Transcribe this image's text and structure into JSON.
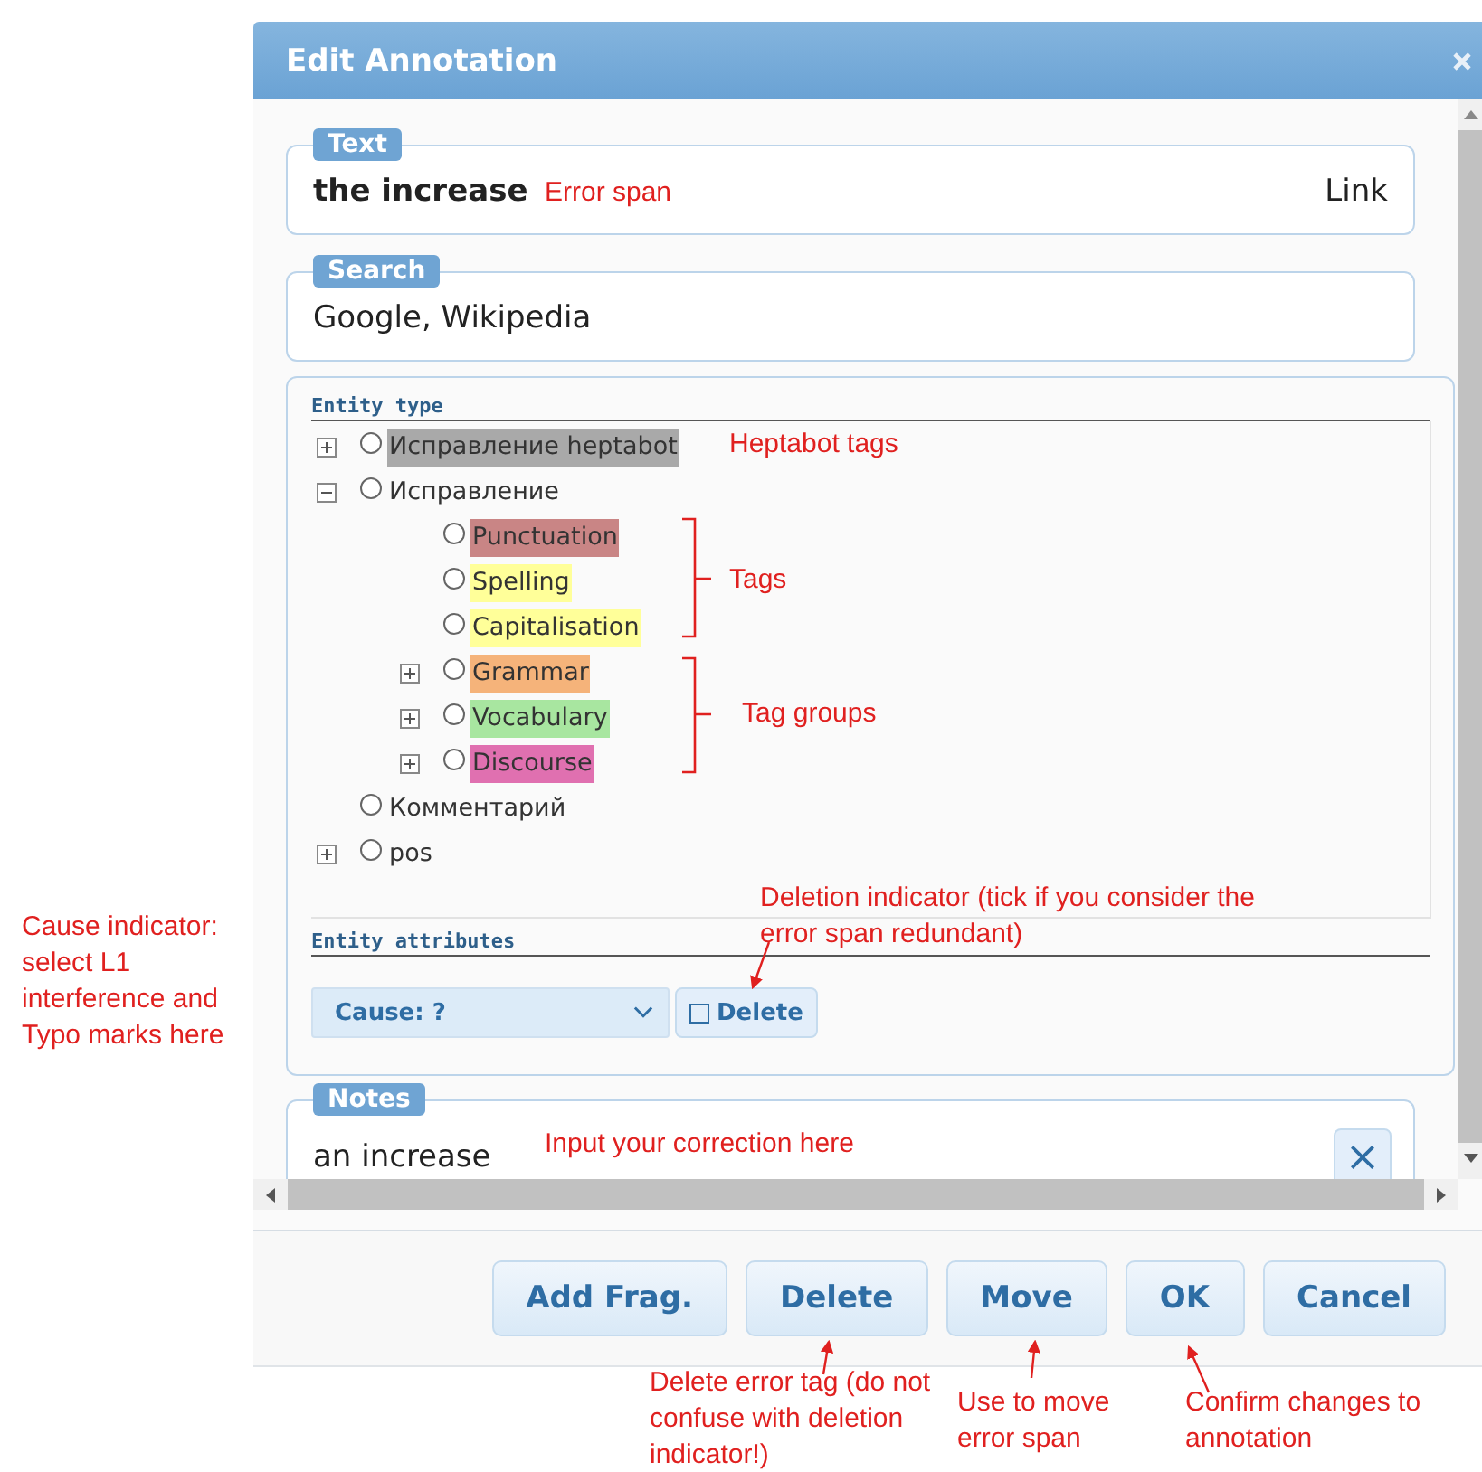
{
  "window": {
    "title": "Edit Annotation"
  },
  "text_section": {
    "legend": "Text",
    "value": "the increase",
    "link": "Link"
  },
  "search_section": {
    "legend": "Search",
    "value": "Google, Wikipedia"
  },
  "entity_type": {
    "heading": "Entity type",
    "tree": [
      {
        "label": "Исправление heptabot",
        "kind": "group",
        "expanded": false,
        "selected": false,
        "color": "#a9a9a9"
      },
      {
        "label": "Исправление",
        "kind": "group",
        "expanded": true,
        "selected": false,
        "children": [
          {
            "label": "Punctuation",
            "kind": "leaf",
            "selected": false,
            "color": "#c98585"
          },
          {
            "label": "Spelling",
            "kind": "leaf",
            "selected": false,
            "color": "#ffff99"
          },
          {
            "label": "Capitalisation",
            "kind": "leaf",
            "selected": false,
            "color": "#ffff99"
          },
          {
            "label": "Grammar",
            "kind": "group",
            "expanded": false,
            "selected": false,
            "color": "#f5b37a"
          },
          {
            "label": "Vocabulary",
            "kind": "group",
            "expanded": false,
            "selected": false,
            "color": "#a8e6a0"
          },
          {
            "label": "Discourse",
            "kind": "group",
            "expanded": false,
            "selected": false,
            "color": "#e070b0"
          }
        ]
      },
      {
        "label": "Комментарий",
        "kind": "leaf",
        "selected": false
      },
      {
        "label": "pos",
        "kind": "group",
        "expanded": false,
        "selected": false
      }
    ]
  },
  "entity_attributes": {
    "heading": "Entity attributes",
    "cause": "Cause: ?",
    "delete": {
      "label": "Delete",
      "checked": false
    }
  },
  "notes_section": {
    "legend": "Notes",
    "value": "an increase"
  },
  "buttons": [
    "Add Frag.",
    "Delete",
    "Move",
    "OK",
    "Cancel"
  ],
  "annotations": [
    "Error span",
    "Heptabot tags",
    "Tags",
    "Tag groups",
    "Cause indicator: select L1 interference and Typo marks here",
    "Deletion indicator (tick if you consider the error span redundant)",
    "Input your correction here",
    "Delete error tag (do not confuse with deletion indicator!)",
    "Use to move error span",
    "Confirm changes to annotation"
  ]
}
